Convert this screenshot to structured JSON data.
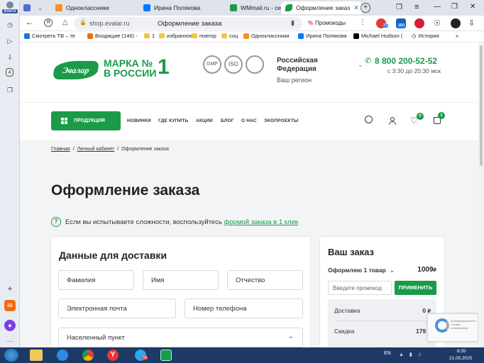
{
  "browser": {
    "profile_label": "Войти",
    "tabs": [
      {
        "label": "Одноклассники"
      },
      {
        "label": "Ирина Полякова"
      },
      {
        "label": "WMmail.ru - сервис по"
      },
      {
        "label": "Оформление заказ"
      }
    ],
    "url": "shop.evalar.ru",
    "page_title": "Оформление заказа",
    "promo_label": "Промокоды",
    "badges": {
      "mail": "21",
      "mail2": "380"
    },
    "bookmarks": [
      "Смотреть ТВ – те",
      "Входящие (146) -",
      "1",
      "избранное",
      "повтор",
      "соц",
      "Одноклассники",
      "Ирина Полякова",
      "Michael Hudson (",
      "История"
    ]
  },
  "site": {
    "logo_text": "Эвалар",
    "slogan_line1": "МАРКА №",
    "slogan_num": "1",
    "slogan_line2": "В РОССИИ",
    "cert_badges": [
      "GMP",
      "ISO",
      ""
    ],
    "region_title": "Российская Федерация",
    "region_sub": "Ваш регион",
    "phone": "8 800 200-52-52",
    "hours": "с 3:30 до 20:30 мск",
    "menu": {
      "products_label": "ПРОДУКЦИЯ",
      "items": [
        "НОВИНКИ",
        "ГДЕ КУПИТЬ",
        "АКЦИИ",
        "БЛОГ",
        "О НАС",
        "ЭКОПРОЕКТЫ"
      ]
    },
    "fav_count": "0",
    "cart_count": "1"
  },
  "breadcrumb": [
    "Главная",
    "Личный кабинет",
    "Оформление заказа"
  ],
  "page": {
    "heading": "Оформление заказа",
    "help_text": "Если вы испытываете сложности, воспользуйтесь ",
    "help_link": "формой заказа в 1 клик"
  },
  "delivery": {
    "title": "Данные для доставки",
    "fields": {
      "last_name": "Фамилия",
      "first_name": "Имя",
      "patronymic": "Отчество",
      "email": "Электронная почта",
      "phone": "Номер телефона",
      "city": "Населенный пункт"
    }
  },
  "order": {
    "title": "Ваш заказ",
    "items_label": "Оформляю 1 товар",
    "total": "1009",
    "currency": "₽",
    "promo_placeholder": "Введите промокод",
    "apply_label": "ПРИМЕНИТЬ",
    "delivery_label": "Доставка",
    "delivery_value": "0",
    "discount_label": "Скидка",
    "discount_value": "179"
  },
  "recaptcha": {
    "text": "Конфиденциальность - Условия использования"
  },
  "taskbar": {
    "lang": "EN",
    "time": "8:35",
    "date": "21.05.2025",
    "telegram_badge": "34"
  }
}
